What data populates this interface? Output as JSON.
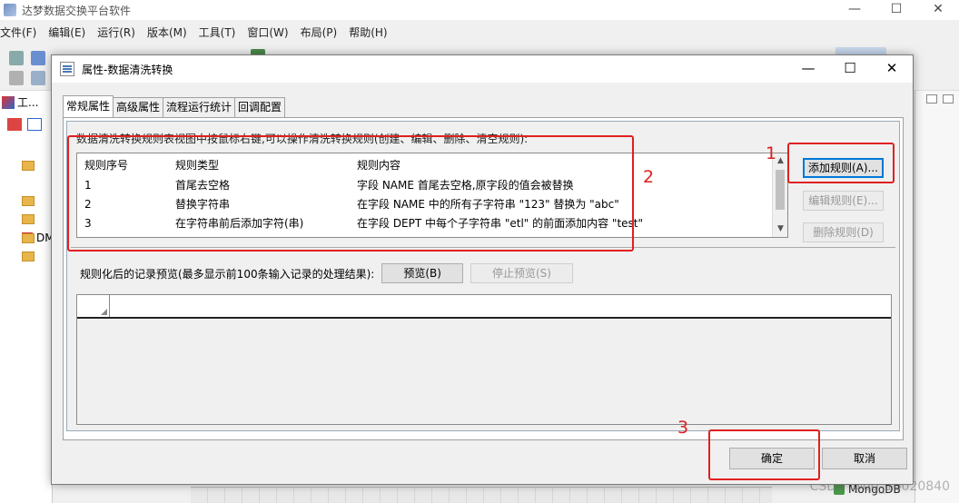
{
  "app": {
    "title": "达梦数据交换平台软件",
    "window_controls": [
      "—",
      "☐",
      "✕"
    ],
    "menu": [
      "文件(F)",
      "编辑(E)",
      "运行(R)",
      "版本(M)",
      "工具(T)",
      "窗口(W)",
      "布局(P)",
      "帮助(H)"
    ],
    "left_tab": "工...",
    "tree_root": "DM",
    "bottom_item": "MongoDB",
    "watermark": "CSDN @qq_16020840"
  },
  "dialog": {
    "title": "属性-数据清洗转换",
    "controls": [
      "—",
      "☐",
      "✕"
    ],
    "tabs": [
      "常规属性",
      "高级属性",
      "流程运行统计",
      "回调配置"
    ],
    "active_tab": 0,
    "description": "数据清洗转换规则表视图中按鼠标右键,可以操作清洗转换规则(创建、编辑、删除、清空规则):",
    "table": {
      "headers": [
        "规则序号",
        "规则类型",
        "规则内容"
      ],
      "rows": [
        [
          "1",
          "首尾去空格",
          "字段 NAME 首尾去空格,原字段的值会被替换"
        ],
        [
          "2",
          "替换字符串",
          "在字段 NAME 中的所有子字符串 \"123\" 替换为 \"abc\""
        ],
        [
          "3",
          "在字符串前后添加字符(串)",
          "在字段 DEPT 中每个子字符串 \"etl\" 的前面添加内容 \"test\""
        ]
      ]
    },
    "buttons": {
      "add": "添加规则(A)...",
      "edit": "编辑规则(E)...",
      "delete": "删除规则(D)",
      "preview": "预览(B)",
      "stop_preview": "停止预览(S)",
      "ok": "确定",
      "cancel": "取消"
    },
    "preview_label": "规则化后的记录预览(最多显示前100条输入记录的处理结果):"
  },
  "annotations": {
    "n1": "1",
    "n2": "2",
    "n3": "3",
    "color": "#e02020"
  }
}
